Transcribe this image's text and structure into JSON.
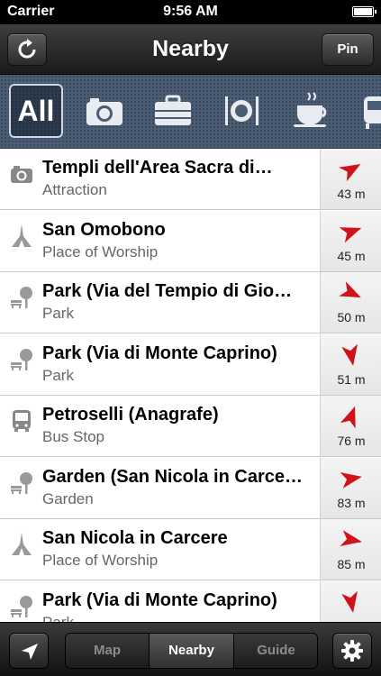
{
  "status": {
    "carrier": "Carrier",
    "time": "9:56 AM"
  },
  "nav": {
    "title": "Nearby",
    "pin_label": "Pin"
  },
  "categories": {
    "all_label": "All",
    "items": [
      "camera-icon",
      "briefcase-icon",
      "plate-cutlery-icon",
      "coffee-cup-icon",
      "train-icon"
    ]
  },
  "colors": {
    "arrow": "#d0131a",
    "category_bar": "#4a5d75",
    "subtitle": "#666666"
  },
  "places": [
    {
      "icon": "camera-icon",
      "title": "Templi dell'Area Sacra di…",
      "subtitle": "Attraction",
      "distance": "43 m",
      "bearing": 60
    },
    {
      "icon": "spire-icon",
      "title": "San Omobono",
      "subtitle": "Place of Worship",
      "distance": "45 m",
      "bearing": 70
    },
    {
      "icon": "park-bench-tree-icon",
      "title": "Park (Via del Tempio di Gio…",
      "subtitle": "Park",
      "distance": "50 m",
      "bearing": 115
    },
    {
      "icon": "park-bench-tree-icon",
      "title": "Park (Via di Monte Caprino)",
      "subtitle": "Park",
      "distance": "51 m",
      "bearing": 170
    },
    {
      "icon": "bus-icon",
      "title": "Petroselli (Anagrafe)",
      "subtitle": "Bus Stop",
      "distance": "76 m",
      "bearing": 20
    },
    {
      "icon": "park-bench-tree-icon",
      "title": "Garden (San Nicola in Carce…",
      "subtitle": "Garden",
      "distance": "83 m",
      "bearing": 80
    },
    {
      "icon": "spire-icon",
      "title": "San Nicola in Carcere",
      "subtitle": "Place of Worship",
      "distance": "85 m",
      "bearing": 100
    },
    {
      "icon": "park-bench-tree-icon",
      "title": "Park (Via di Monte Caprino)",
      "subtitle": "Park",
      "distance": "",
      "bearing": 170
    }
  ],
  "tabs": {
    "items": [
      "Map",
      "Nearby",
      "Guide"
    ],
    "active": "Nearby"
  }
}
